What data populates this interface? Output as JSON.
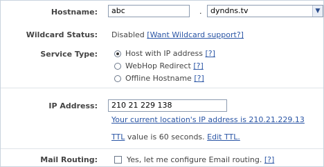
{
  "form": {
    "hostname": {
      "label": "Hostname:",
      "value": "abc",
      "separator": ".",
      "domain": "dyndns.tv"
    },
    "wildcard": {
      "label": "Wildcard Status:",
      "status": "Disabled",
      "link_text": "[Want Wildcard support?]"
    },
    "service_type": {
      "label": "Service Type:",
      "options": [
        {
          "label": "Host with IP address",
          "help": "[?]",
          "selected": true
        },
        {
          "label": "WebHop Redirect",
          "help": "[?]",
          "selected": false
        },
        {
          "label": "Offline Hostname",
          "help": "[?]",
          "selected": false
        }
      ]
    },
    "ip_address": {
      "label": "IP Address:",
      "value": "210 21 229 138",
      "location_note": "Your current location's IP address is 210.21.229.13",
      "ttl_link": "TTL",
      "ttl_text": "value is 60 seconds.",
      "edit_ttl": "Edit TTL."
    },
    "mail_routing": {
      "label": "Mail Routing:",
      "checkbox_label": "Yes, let me configure Email routing.",
      "help": "[?]"
    }
  }
}
